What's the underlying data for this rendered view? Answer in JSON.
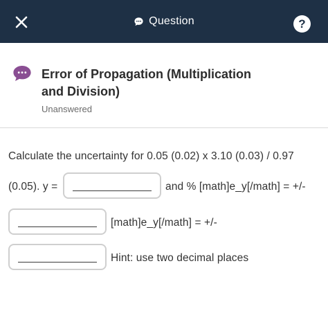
{
  "topbar": {
    "close_icon": "close-icon",
    "title": "Question",
    "title_icon": "chat-bubble-icon",
    "help_icon": "help-circle-icon",
    "help_glyph": "?",
    "background": "#1e3045"
  },
  "question": {
    "icon": "question-bubble-icon",
    "icon_color": "#8a4e93",
    "title": "Error of Propagation (Multiplication and Division)",
    "status": "Unanswered"
  },
  "body": {
    "line1": "Calculate the uncertainty for 0.05 (0.02) x 3.10 (0.03) / 0.97",
    "line2_prefix": "(0.05). y =",
    "after_field1": "and % [math]e_y[/math] = +/-",
    "after_field2": "[math]e_y[/math] = +/-",
    "hint": "Hint: use two decimal places",
    "fields": [
      {
        "label": "y",
        "value": ""
      },
      {
        "label": "% e_y",
        "value": ""
      },
      {
        "label": "e_y",
        "value": ""
      }
    ]
  }
}
